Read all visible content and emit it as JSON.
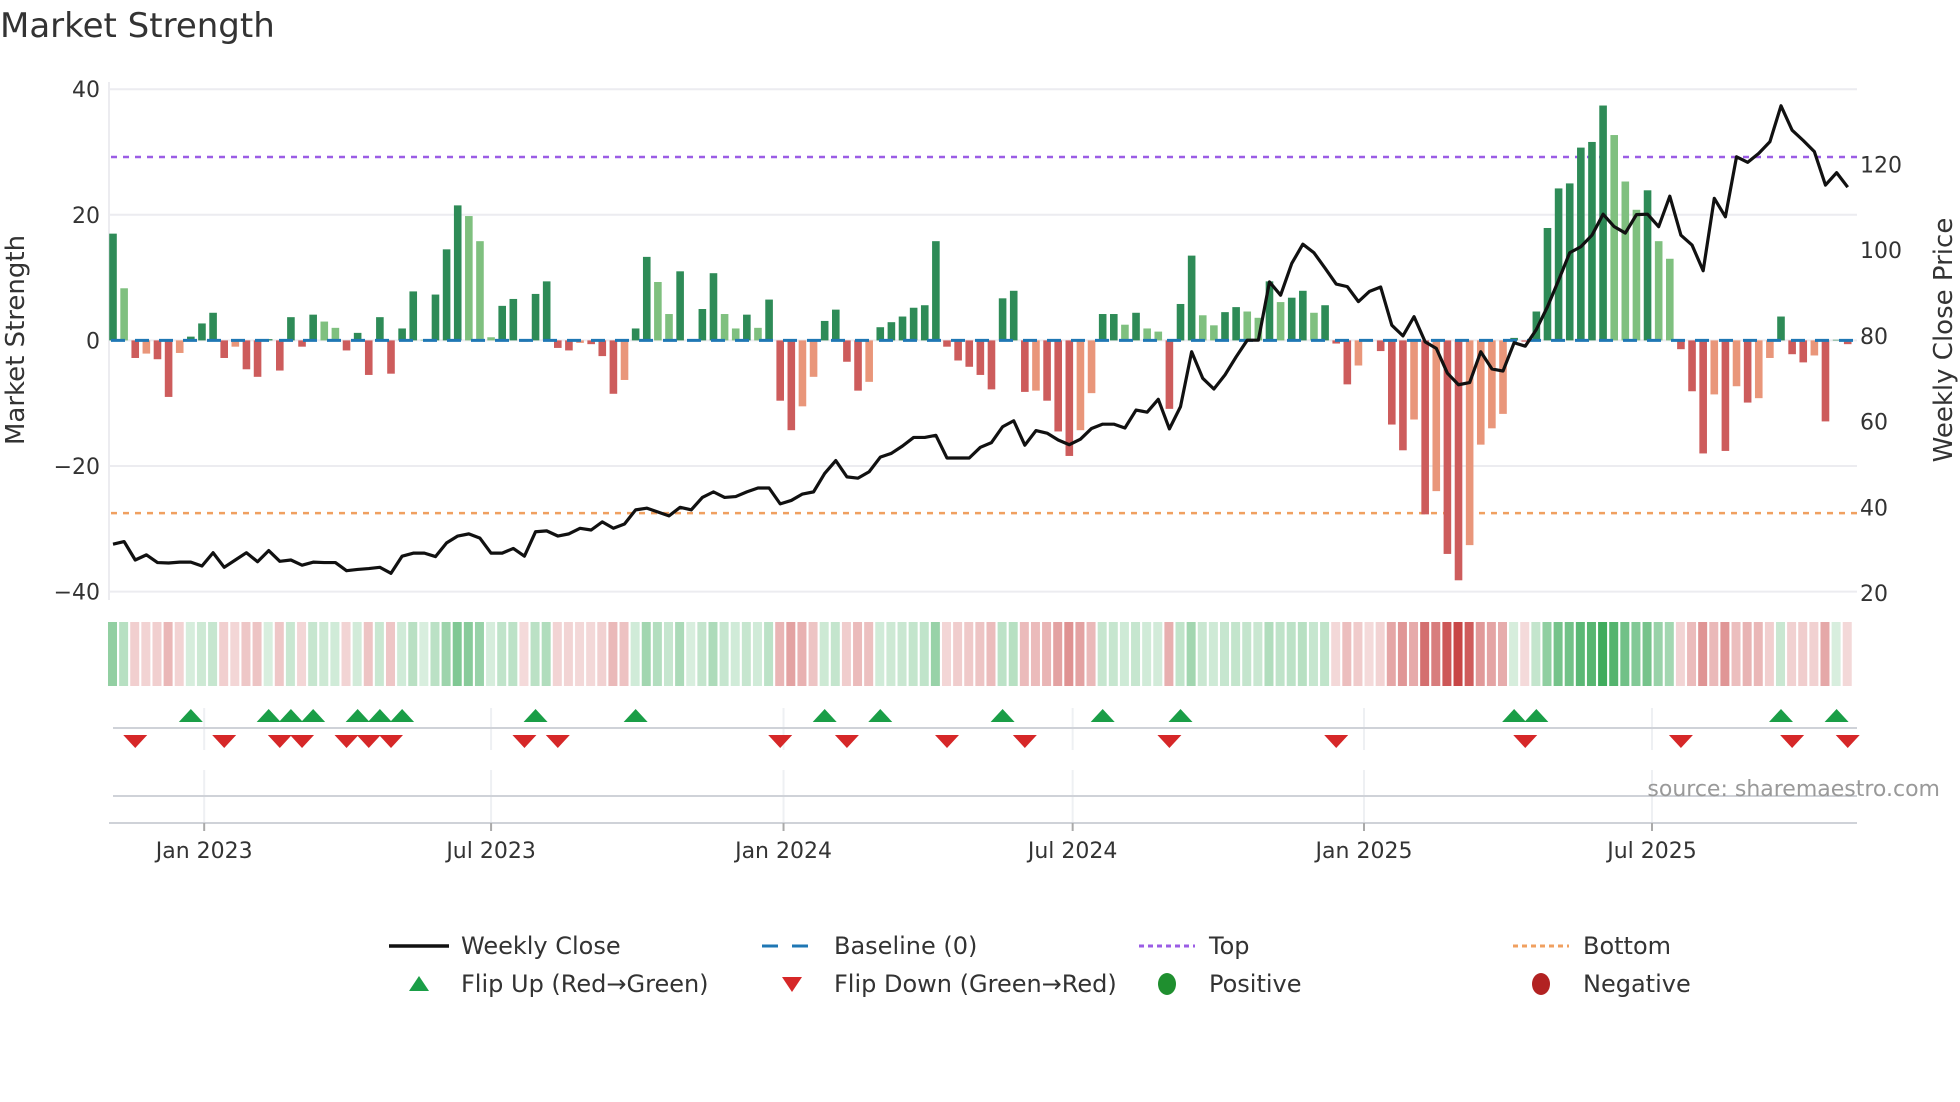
{
  "title": "Market Strength",
  "source": "source: sharemaestro.com",
  "legend": [
    {
      "label": "Weekly Close",
      "symbol": "solid-line",
      "color": "#111111"
    },
    {
      "label": "Baseline (0)",
      "symbol": "dashed-line",
      "color": "#1f77b4"
    },
    {
      "label": "Top",
      "symbol": "dotted-line",
      "color": "#9b5de5"
    },
    {
      "label": "Bottom",
      "symbol": "dotted-line",
      "color": "#f0a060"
    },
    {
      "label": "Flip Up (Red→Green)",
      "symbol": "triangle-up",
      "color": "#1a9e47"
    },
    {
      "label": "Flip Down (Green→Red)",
      "symbol": "triangle-down",
      "color": "#d62728"
    },
    {
      "label": "Positive",
      "symbol": "circle",
      "color": "#1f8f2f"
    },
    {
      "label": "Negative",
      "symbol": "circle",
      "color": "#b22222"
    }
  ],
  "chart_data": {
    "type": "bar",
    "title": "Market Strength",
    "ylabel": "Market Strength",
    "y2label": "Weekly Close Price",
    "ylim": [
      -40,
      40
    ],
    "y2lim": [
      20,
      137.7
    ],
    "yticks": [
      40,
      20,
      0,
      -20,
      -40
    ],
    "ytick_labels": [
      "40",
      "20",
      "0",
      "−20",
      "−40"
    ],
    "y2ticks": [
      120,
      100,
      80,
      60,
      40,
      20
    ],
    "xtick_labels": [
      "Jan 2023",
      "Jul 2023",
      "Jan 2024",
      "Jul 2024",
      "Jan 2025",
      "Jul 2025"
    ],
    "xtick_weeks": [
      8.2,
      34.0,
      60.3,
      86.3,
      112.5,
      138.4
    ],
    "frequency": "weekly",
    "grid": true,
    "legend_position": "bottom",
    "reference_lines": {
      "top": 29.2,
      "bottom": -27.5,
      "baseline": 0
    },
    "colors": {
      "pos_strong": "#2e8b57",
      "pos_weak": "#7fc07f",
      "neg_strong": "#cd5c5c",
      "neg_weak": "#e9967a"
    },
    "series": [
      {
        "name": "Market Strength",
        "axis": "left",
        "type": "bar",
        "values": [
          17,
          8.3,
          -2.8,
          -2.1,
          -3,
          -9,
          -2,
          0.6,
          2.7,
          4.4,
          -2.8,
          -1,
          -4.6,
          -5.8,
          0.2,
          -4.8,
          3.7,
          -1,
          4.1,
          3,
          2,
          -1.6,
          1.2,
          -5.5,
          3.7,
          -5.3,
          1.9,
          7.8,
          0.1,
          7.3,
          14.5,
          21.5,
          19.8,
          15.8,
          0.5,
          5.5,
          6.6,
          -0.2,
          7.4,
          9.4,
          -1.2,
          -1.6,
          -0.4,
          -0.6,
          -2.5,
          -8.5,
          -6.3,
          1.9,
          13.3,
          9.3,
          4.2,
          11,
          0.2,
          5,
          10.7,
          4.2,
          1.9,
          4.1,
          2,
          6.5,
          -9.6,
          -14.3,
          -10.5,
          -5.8,
          3.1,
          4.9,
          -3.4,
          -8,
          -6.6,
          2.1,
          2.9,
          3.8,
          5.2,
          5.6,
          15.8,
          -1,
          -3.2,
          -4.2,
          -5.5,
          -7.8,
          6.7,
          7.9,
          -8.2,
          -8,
          -9.6,
          -14.5,
          -18.4,
          -14.3,
          -8.4,
          4.2,
          4.2,
          2.5,
          4.4,
          1.9,
          1.4,
          -10.9,
          5.8,
          13.5,
          4,
          2.4,
          4.5,
          5.3,
          4.6,
          3.6,
          9.4,
          6.1,
          6.8,
          7.9,
          4.4,
          5.6,
          -0.5,
          -7,
          -4,
          -0.2,
          -1.7,
          -13.4,
          -17.5,
          -12.6,
          -27.7,
          -24,
          -34,
          -38.2,
          -32.6,
          -16.6,
          -14,
          -11.7,
          0.4,
          -0.2,
          4.6,
          17.9,
          24.2,
          25,
          30.7,
          31.6,
          37.4,
          32.7,
          25.3,
          20.8,
          23.9,
          15.8,
          13,
          -1.4,
          -8.1,
          -18,
          -8.6,
          -17.6,
          -7.3,
          -9.9,
          -9.2,
          -2.8,
          3.8,
          -2.2,
          -3.5,
          -2.4,
          -12.9,
          0.1,
          -0.6
        ]
      },
      {
        "name": "Weekly Close",
        "axis": "right",
        "type": "line",
        "values": [
          31.4,
          32,
          27.7,
          28.9,
          27.1,
          27,
          27.2,
          27.2,
          26.3,
          29.4,
          26,
          27.7,
          29.4,
          27.3,
          29.9,
          27.4,
          27.7,
          26.5,
          27.2,
          27.1,
          27.1,
          25.2,
          25.5,
          25.7,
          26,
          24.6,
          28.6,
          29.3,
          29.3,
          28.5,
          31.7,
          33.3,
          33.8,
          32.8,
          29.3,
          29.3,
          30.4,
          28.6,
          34.3,
          34.5,
          33.3,
          33.8,
          35.1,
          34.7,
          36.6,
          35.1,
          36.1,
          39.4,
          39.8,
          38.9,
          38,
          40,
          39.4,
          42.3,
          43.6,
          42.3,
          42.5,
          43.6,
          44.5,
          44.5,
          40.8,
          41.6,
          43.1,
          43.6,
          47.9,
          50.9,
          47.1,
          46.8,
          48.3,
          51.7,
          52.6,
          54.3,
          56.3,
          56.3,
          56.8,
          51.5,
          51.5,
          51.5,
          54,
          55.1,
          58.8,
          60.2,
          54.5,
          57.9,
          57.3,
          55.7,
          54.6,
          55.9,
          58.4,
          59.4,
          59.4,
          58.5,
          62.7,
          62.2,
          65.2,
          58.3,
          63.5,
          76.3,
          70.1,
          67.6,
          70.9,
          75.1,
          79,
          79,
          92.6,
          89.5,
          96.9,
          101.4,
          99.4,
          95.8,
          92.1,
          91.5,
          88,
          90.4,
          91.4,
          82.5,
          80,
          84.5,
          78.6,
          77.1,
          71.3,
          68.6,
          69.1,
          76.3,
          72.3,
          71.8,
          78.4,
          77.6,
          81.5,
          86.8,
          93,
          99.4,
          100.8,
          103.5,
          108.4,
          105.5,
          104,
          108.3,
          108.4,
          105.5,
          112.6,
          103.5,
          101.2,
          95.2,
          112.1,
          107.8,
          121.8,
          120.5,
          122.6,
          125.3,
          133.7,
          128,
          125.6,
          123,
          115.2,
          118.1,
          114.7
        ]
      }
    ],
    "flip_up_weeks": [
      7,
      14,
      16,
      18,
      22,
      24,
      26,
      38,
      47,
      64,
      69,
      80,
      89,
      96,
      126,
      128,
      150,
      155
    ],
    "flip_down_weeks": [
      2,
      10,
      15,
      17,
      21,
      23,
      25,
      37,
      40,
      60,
      66,
      75,
      82,
      95,
      110,
      127,
      141,
      151,
      156
    ]
  }
}
